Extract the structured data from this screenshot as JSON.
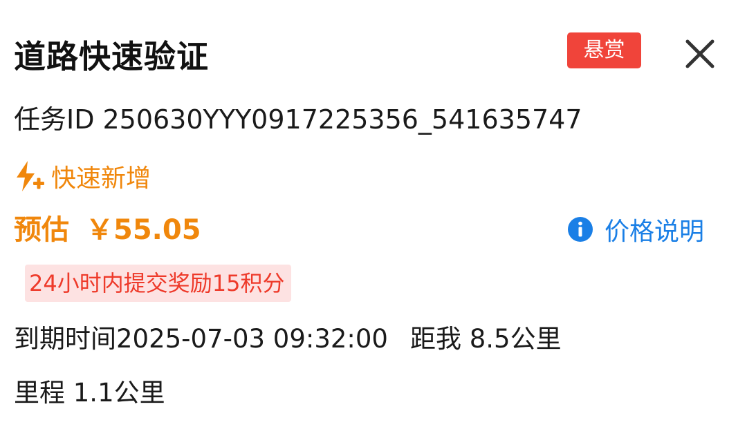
{
  "card": {
    "title": "道路快速验证",
    "badge": "悬赏",
    "close_icon": "close-icon"
  },
  "task": {
    "id_label": "任务ID",
    "id_value": "250630YYY0917225356_541635747"
  },
  "tag": {
    "icon": "lightning-plus-icon",
    "label": "快速新增",
    "color": "#f0870c"
  },
  "estimate": {
    "label": "预估",
    "price": "￥55.05",
    "color": "#f0870c"
  },
  "price_note": {
    "icon": "info-icon",
    "label": "价格说明",
    "color": "#1a7fe6"
  },
  "reward": {
    "text": "24小时内提交奖励15积分",
    "color": "#ee3a2a",
    "background": "#fde2e2"
  },
  "expire": {
    "text": "到期时间2025-07-03 09:32:00",
    "distance": "距我 8.5公里"
  },
  "mileage": {
    "text": "里程 1.1公里"
  }
}
